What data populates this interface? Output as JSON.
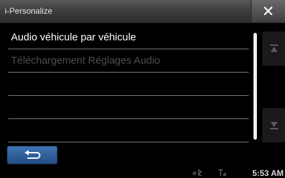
{
  "window": {
    "title": "i-Personalize",
    "close_icon": "close-icon"
  },
  "list": {
    "items": [
      {
        "label": "Audio véhicule par véhicule",
        "state": "active"
      },
      {
        "label": "Téléchargement Réglages Audio",
        "state": "disabled"
      },
      {
        "label": ""
      },
      {
        "label": ""
      },
      {
        "label": ""
      }
    ]
  },
  "scrollbar": {
    "up_icon": "scroll-top-icon",
    "down_icon": "scroll-bottom-icon",
    "position_fraction": 0
  },
  "footer": {
    "back_icon": "return-arrow-icon"
  },
  "status": {
    "time": "5:53 AM",
    "icons": [
      "bluetooth-icon",
      "signal-icon"
    ]
  },
  "colors": {
    "title_bar": "#3c3c3c",
    "accent_blue": "#2f5f9a",
    "text_active": "#ffffff",
    "text_disabled": "#4e4e4e"
  }
}
